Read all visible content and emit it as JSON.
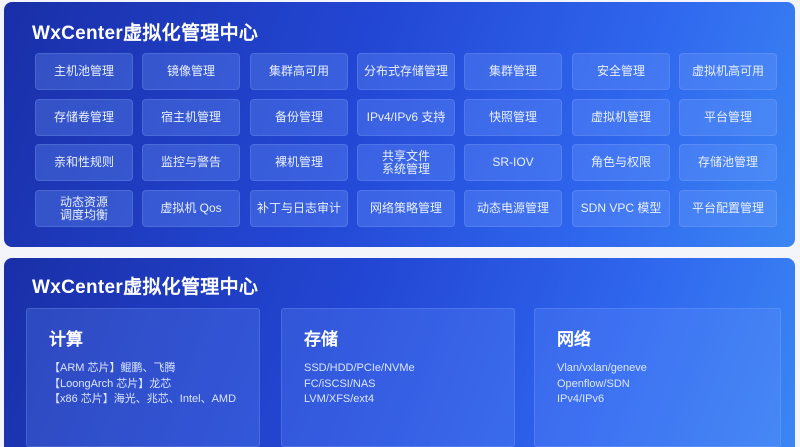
{
  "top": {
    "title": "WxCenter虚拟化管理中心",
    "rows": [
      [
        "主机池管理",
        "镜像管理",
        "集群高可用",
        "分布式存储管理",
        "集群管理",
        "安全管理",
        "虚拟机高可用"
      ],
      [
        "存储卷管理",
        "宿主机管理",
        "备份管理",
        "IPv4/IPv6 支持",
        "快照管理",
        "虚拟机管理",
        "平台管理"
      ],
      [
        "亲和性规则",
        "监控与警告",
        "裸机管理",
        "共享文件\n系统管理",
        "SR-IOV",
        "角色与权限",
        "存储池管理"
      ],
      [
        "动态资源\n调度均衡",
        "虚拟机 Qos",
        "补丁与日志审计",
        "网络策略管理",
        "动态电源管理",
        "SDN VPC 模型",
        "平台配置管理"
      ]
    ]
  },
  "bottom": {
    "title": "WxCenter虚拟化管理中心",
    "cards": [
      {
        "title": "计算",
        "lines": [
          "【ARM 芯片】鲲鹏、飞腾",
          "【LoongArch 芯片】龙芯",
          "【x86 芯片】海光、兆芯、Intel、AMD"
        ]
      },
      {
        "title": "存储",
        "lines": [
          "SSD/HDD/PCIe/NVMe",
          "FC/iSCSI/NAS",
          "LVM/XFS/ext4"
        ]
      },
      {
        "title": "网络",
        "lines": [
          "Vlan/vxlan/geneve",
          "Openflow/SDN",
          "IPv4/IPv6"
        ]
      }
    ]
  }
}
